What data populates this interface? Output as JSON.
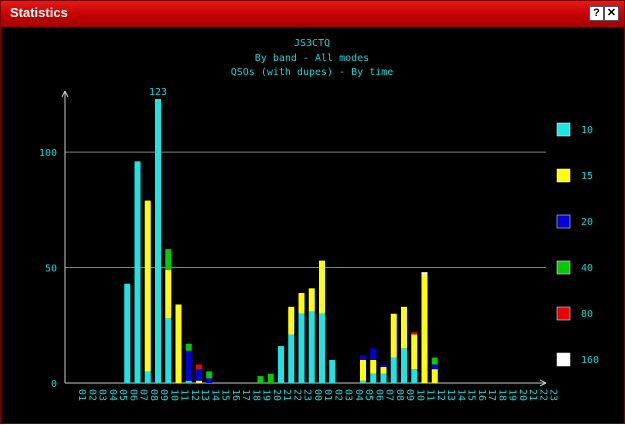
{
  "window": {
    "title": "Statistics",
    "help_label": "?",
    "close_label": "✕"
  },
  "chart_data": {
    "type": "bar",
    "stacked": true,
    "title": "JS3CTQ",
    "subtitle_lines": [
      "By band - All modes",
      "QSOs (with dupes) - By time"
    ],
    "max_label": "123",
    "categories": [
      "01",
      "02",
      "03",
      "04",
      "05",
      "06",
      "07",
      "08",
      "09",
      "10",
      "11",
      "12",
      "13",
      "14",
      "15",
      "16",
      "17",
      "18",
      "19",
      "20",
      "21",
      "22",
      "23",
      "00",
      "01",
      "02",
      "03",
      "04",
      "05",
      "06",
      "07",
      "08",
      "09",
      "10",
      "11",
      "12",
      "13",
      "14",
      "15",
      "16",
      "17",
      "18",
      "19",
      "20",
      "21",
      "22",
      "23"
    ],
    "ylim": [
      0,
      123
    ],
    "yticks": [
      0,
      50,
      100
    ],
    "grid": true,
    "legend_position": "right",
    "series": [
      {
        "name": "10",
        "color": "#19e5e5",
        "values": [
          0,
          0,
          0,
          0,
          0,
          43,
          96,
          5,
          123,
          28,
          0,
          1,
          0,
          0,
          0,
          0,
          0,
          0,
          0,
          0,
          16,
          21,
          30,
          31,
          30,
          10,
          0,
          0,
          1,
          4,
          4,
          11,
          15,
          6,
          0,
          0,
          0,
          0,
          0,
          0,
          0,
          0,
          0,
          0,
          0,
          0,
          0
        ]
      },
      {
        "name": "15",
        "color": "#ffff00",
        "values": [
          0,
          0,
          0,
          0,
          0,
          0,
          0,
          74,
          0,
          21,
          34,
          0,
          1,
          0,
          0,
          0,
          0,
          0,
          0,
          0,
          0,
          12,
          9,
          10,
          23,
          0,
          0,
          0,
          9,
          6,
          3,
          19,
          18,
          15,
          47,
          6,
          0,
          0,
          0,
          0,
          0,
          0,
          0,
          0,
          0,
          0,
          0
        ]
      },
      {
        "name": "20",
        "color": "#0000dd",
        "values": [
          0,
          0,
          0,
          0,
          0,
          0,
          0,
          0,
          0,
          0,
          0,
          13,
          5,
          2,
          0,
          0,
          0,
          0,
          0,
          0,
          0,
          0,
          0,
          0,
          0,
          0,
          0,
          0,
          2,
          5,
          1,
          0,
          0,
          0,
          0,
          2,
          0,
          0,
          0,
          0,
          0,
          0,
          0,
          0,
          0,
          0,
          0
        ]
      },
      {
        "name": "40",
        "color": "#00cc00",
        "values": [
          0,
          0,
          0,
          0,
          0,
          0,
          0,
          0,
          0,
          9,
          0,
          3,
          0,
          3,
          0,
          0,
          0,
          0,
          3,
          4,
          0,
          0,
          0,
          0,
          0,
          0,
          0,
          0,
          0,
          0,
          0,
          0,
          0,
          0,
          0,
          3,
          0,
          0,
          0,
          0,
          0,
          0,
          0,
          0,
          0,
          0,
          0
        ]
      },
      {
        "name": "80",
        "color": "#ee0000",
        "values": [
          0,
          0,
          0,
          0,
          0,
          0,
          0,
          0,
          0,
          0,
          0,
          0,
          2,
          0,
          0,
          0,
          0,
          0,
          0,
          0,
          0,
          0,
          0,
          0,
          0,
          0,
          0,
          0,
          0,
          0,
          0,
          0,
          0,
          1,
          0,
          0,
          0,
          0,
          0,
          0,
          0,
          0,
          0,
          0,
          0,
          0,
          0
        ]
      },
      {
        "name": "160",
        "color": "#ffffff",
        "values": [
          0,
          0,
          0,
          0,
          0,
          0,
          0,
          0,
          0,
          0,
          0,
          0,
          0,
          0,
          0,
          0,
          0,
          0,
          0,
          0,
          0,
          0,
          0,
          0,
          0,
          0,
          0,
          0,
          0,
          0,
          0,
          0,
          0,
          0,
          1,
          0,
          0,
          0,
          0,
          0,
          0,
          0,
          0,
          0,
          0,
          0,
          0
        ]
      }
    ]
  }
}
